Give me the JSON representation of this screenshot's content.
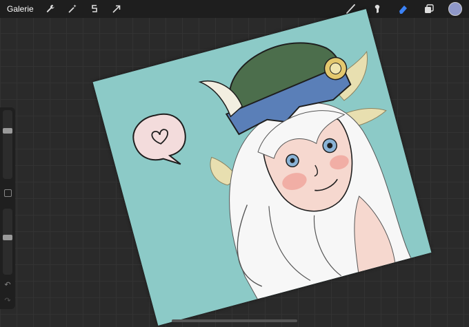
{
  "toolbar": {
    "gallery_label": "Galerie",
    "left_tools": [
      {
        "icon": "wrench-icon"
      },
      {
        "icon": "magic-wand-icon"
      },
      {
        "icon": "selection-icon"
      },
      {
        "icon": "transform-arrow-icon"
      }
    ],
    "right_tools": [
      {
        "icon": "brush-icon"
      },
      {
        "icon": "smudge-icon"
      },
      {
        "icon": "eraser-icon"
      },
      {
        "icon": "layers-icon"
      }
    ],
    "accent_color": "#3b82f6",
    "current_color": "#8f98c9"
  },
  "sidebar": {
    "brush_size_level": 0.72,
    "opacity_level": 0.57,
    "undo_icon": "undo-icon",
    "redo_icon": "redo-icon"
  },
  "canvas": {
    "background_color": "#8ccac7"
  }
}
